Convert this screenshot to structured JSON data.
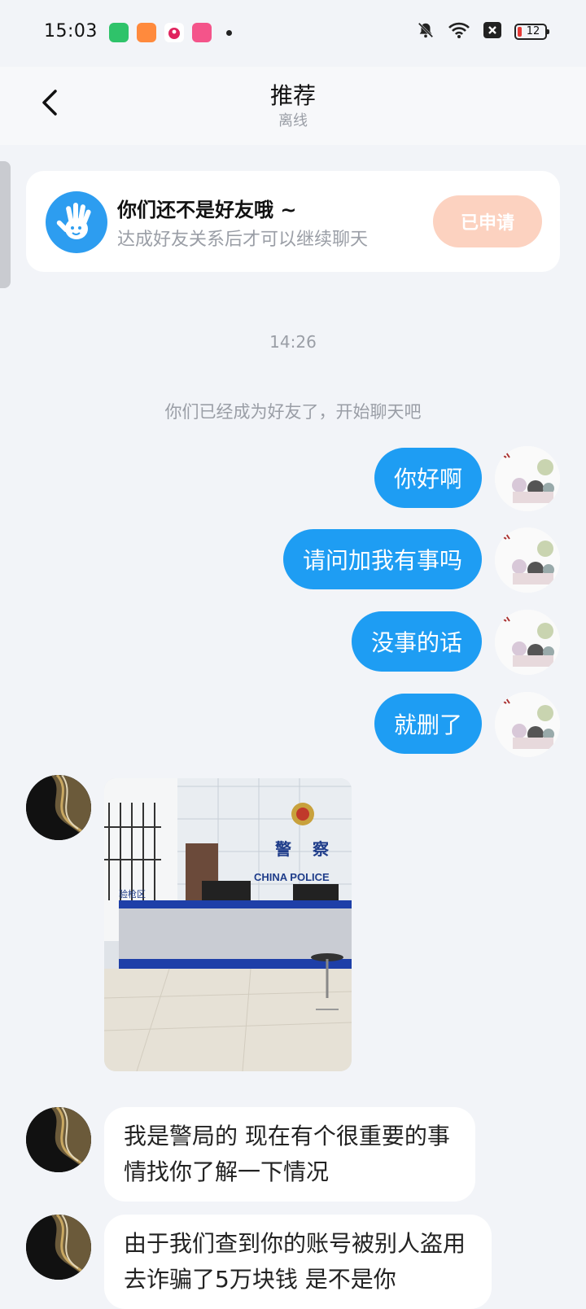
{
  "status_bar": {
    "time": "15:03",
    "battery": "12",
    "icons": [
      "app-green-icon",
      "app-orange-icon",
      "app-red-icon",
      "app-pink-icon",
      "notification-dot-icon",
      "mute-bell-icon",
      "wifi-icon",
      "x-box-icon",
      "battery-icon"
    ]
  },
  "header": {
    "title": "推荐",
    "subtitle": "离线",
    "back_icon": "chevron-left-icon"
  },
  "banner": {
    "title": "你们还不是好友哦 ~",
    "subtitle": "达成好友关系后才可以继续聊天",
    "button_label": "已申请",
    "icon": "hand-wave-icon",
    "colors": {
      "icon_bg": "#2d9df0",
      "button_bg": "#fcd2c0"
    }
  },
  "chat": {
    "timestamp": "14:26",
    "system_message": "你们已经成为好友了，开始聊天吧",
    "outgoing": [
      {
        "text": "你好啊"
      },
      {
        "text": "请问加我有事吗"
      },
      {
        "text": "没事的话"
      },
      {
        "text": "就删了"
      }
    ],
    "incoming": [
      {
        "type": "image",
        "description": "police-station-photo"
      },
      {
        "type": "text",
        "text": "我是警局的 现在有个很重要的事情找你了解一下情况"
      },
      {
        "type": "text",
        "text": "由于我们查到你的账号被别人盗用去诈骗了5万块钱 是不是你"
      }
    ]
  },
  "colors": {
    "accent": "#1e9df3",
    "background": "#f2f4f8",
    "muted_text": "#9a9ea6"
  }
}
